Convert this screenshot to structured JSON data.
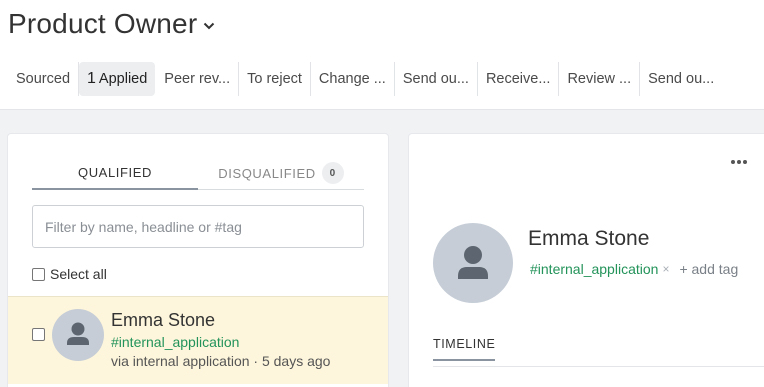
{
  "job": {
    "title": "Product Owner"
  },
  "stages": [
    {
      "count": "",
      "label": "Sourced",
      "active": false
    },
    {
      "count": "1",
      "label": "Applied",
      "active": true
    },
    {
      "count": "",
      "label": "Peer rev...",
      "active": false
    },
    {
      "count": "",
      "label": "To reject",
      "active": false
    },
    {
      "count": "",
      "label": "Change ...",
      "active": false
    },
    {
      "count": "",
      "label": "Send ou...",
      "active": false
    },
    {
      "count": "",
      "label": "Receive...",
      "active": false
    },
    {
      "count": "",
      "label": "Review ...",
      "active": false
    },
    {
      "count": "",
      "label": "Send ou...",
      "active": false
    }
  ],
  "list": {
    "tab_qualified": "QUALIFIED",
    "tab_disqualified": "DISQUALIFIED",
    "disqualified_count": "0",
    "filter_placeholder": "Filter by name, headline or #tag",
    "select_all": "Select all",
    "candidate": {
      "name": "Emma Stone",
      "tag": "#internal_application",
      "meta": "via internal application · 5 days ago"
    }
  },
  "profile": {
    "name": "Emma Stone",
    "tag": "#internal_application",
    "tag_remove": "×",
    "add_tag": "+ add tag",
    "tab_timeline": "TIMELINE"
  },
  "colors": {
    "tag_green": "#23935a",
    "selected_row": "#fef6dc",
    "avatar_bg": "#c6cdd6"
  },
  "icons": {
    "title_chevron": "chevron-down-icon",
    "more": "more-horizontal-icon",
    "avatar": "person-icon"
  }
}
